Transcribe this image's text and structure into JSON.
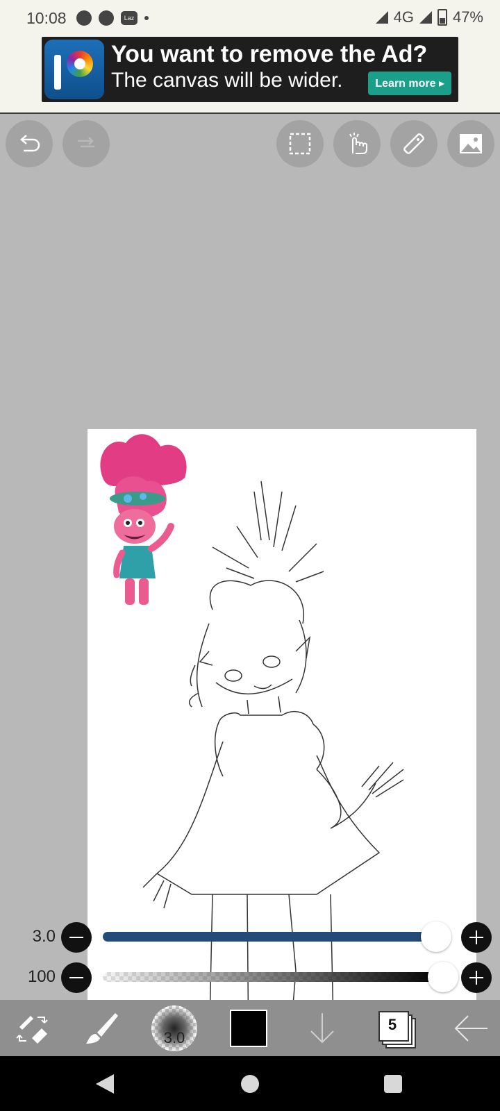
{
  "status_bar": {
    "time": "10:08",
    "network": "4G",
    "battery": "47%"
  },
  "ad": {
    "title": "You want to remove the Ad?",
    "subtitle": "The canvas will be wider.",
    "button_label": "Learn more ▸"
  },
  "top_toolbar": {
    "undo_icon": "undo-icon",
    "redo_icon": "redo-icon",
    "selection_icon": "selection-icon",
    "hand_icon": "hand-icon",
    "ruler_icon": "ruler-icon",
    "image_icon": "image-icon"
  },
  "sliders": {
    "brush_size": {
      "value": "3.0",
      "fraction": 0.98
    },
    "opacity": {
      "value": "100",
      "fraction": 1.0
    }
  },
  "bottom_toolbar": {
    "brush_size_label": "3.0",
    "current_color": "#000000",
    "layer_count": "5"
  },
  "colors": {
    "workspace_bg": "#b8b8b8",
    "size_track": "#234a78",
    "toolbar_bg": "#8f8f8f",
    "ad_button": "#1a9f8a"
  }
}
